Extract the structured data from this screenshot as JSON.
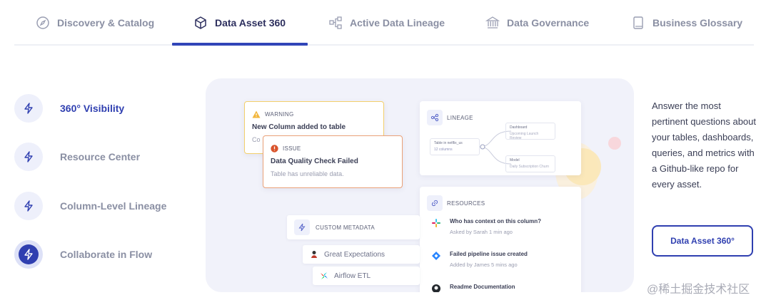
{
  "tabs": [
    {
      "label": "Discovery & Catalog",
      "icon": "compass-icon"
    },
    {
      "label": "Data Asset 360",
      "icon": "cube-icon",
      "active": true
    },
    {
      "label": "Active Data Lineage",
      "icon": "lineage-icon"
    },
    {
      "label": "Data Governance",
      "icon": "bank-icon"
    },
    {
      "label": "Business Glossary",
      "icon": "book-icon"
    }
  ],
  "features": [
    {
      "label": "360° Visibility",
      "icon": "bolt-icon"
    },
    {
      "label": "Resource Center",
      "icon": "bolt-icon"
    },
    {
      "label": "Column-Level Lineage",
      "icon": "bolt-icon"
    },
    {
      "label": "Collaborate in Flow",
      "icon": "bolt-icon"
    }
  ],
  "illustration": {
    "warning": {
      "tag": "WARNING",
      "title": "New Column added to table",
      "sub": "Co"
    },
    "issue": {
      "tag": "ISSUE",
      "title": "Data Quality Check Failed",
      "sub": "Table has unreliable data."
    },
    "lineage": {
      "tag": "LINEAGE",
      "table": "Table in netflix_us",
      "table_sub": "12 columns",
      "dashboard": "Dashboard",
      "dashboard_sub": "Upcoming Launch Review",
      "model": "Model",
      "model_sub": "Daily Subscription Churn"
    },
    "resources": {
      "tag": "RESOURCES",
      "items": [
        {
          "title": "Who has context on this column?",
          "sub": "Asked by Sarah 1 min ago",
          "icon": "slack-icon"
        },
        {
          "title": "Failed pipeline issue created",
          "sub": "Added by James 5 mins ago",
          "icon": "jira-icon"
        },
        {
          "title": "Readme Documentation",
          "sub": "",
          "icon": "github-icon"
        }
      ]
    },
    "custom_metadata": "CUSTOM METADATA",
    "integrations": [
      "Great Expectations",
      "Airflow ETL"
    ]
  },
  "description": "Answer the most pertinent questions about your tables, dashboards, queries, and metrics with a Github-like repo for every asset.",
  "cta_label": "Data Asset 360°",
  "watermark": "@稀土掘金技术社区",
  "colors": {
    "accent": "#2f3fb0",
    "warning": "#f3cf6b",
    "issue": "#eaa178"
  }
}
